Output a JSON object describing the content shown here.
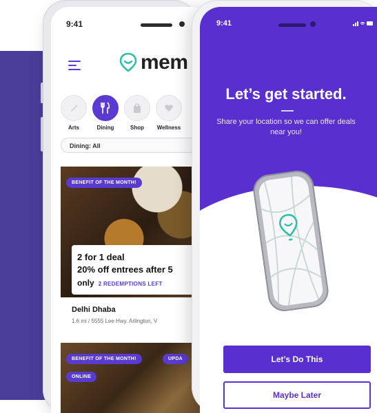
{
  "left_phone": {
    "status_time": "9:41",
    "logo_text": "mem",
    "categories": [
      {
        "label": "Arts",
        "icon": "brush-icon"
      },
      {
        "label": "Dining",
        "icon": "fork-knife-icon"
      },
      {
        "label": "Shop",
        "icon": "shopping-bag-icon"
      },
      {
        "label": "Wellness",
        "icon": "heart-icon"
      }
    ],
    "active_category": "Dining",
    "filter_label": "Dining: All",
    "card1": {
      "badge": "BENEFIT OF THE MONTH!",
      "deal_line1": "2 for 1 deal",
      "deal_line2": "20% off entrees after 5",
      "deal_line3": "only",
      "redemptions": "2 REDEMPTIONS LEFT",
      "place_name": "Delhi Dhaba",
      "place_addr": "1.6 mi / 5555 Lee Hwy. Arlington, V"
    },
    "card2": {
      "badge1": "BENEFIT OF THE MONTH!",
      "badge2": "UPDA",
      "badge3": "ONLINE"
    }
  },
  "right_phone": {
    "status_time": "9:41",
    "headline": "Let’s get started.",
    "subtext": "Share your location so we can offer deals near you!",
    "primary_button": "Let’s Do This",
    "secondary_button": "Maybe Later"
  },
  "colors": {
    "brand_purple": "#5a2fd0",
    "accent_teal": "#2fbfa8",
    "backdrop_indigo": "#4a3d9a"
  }
}
